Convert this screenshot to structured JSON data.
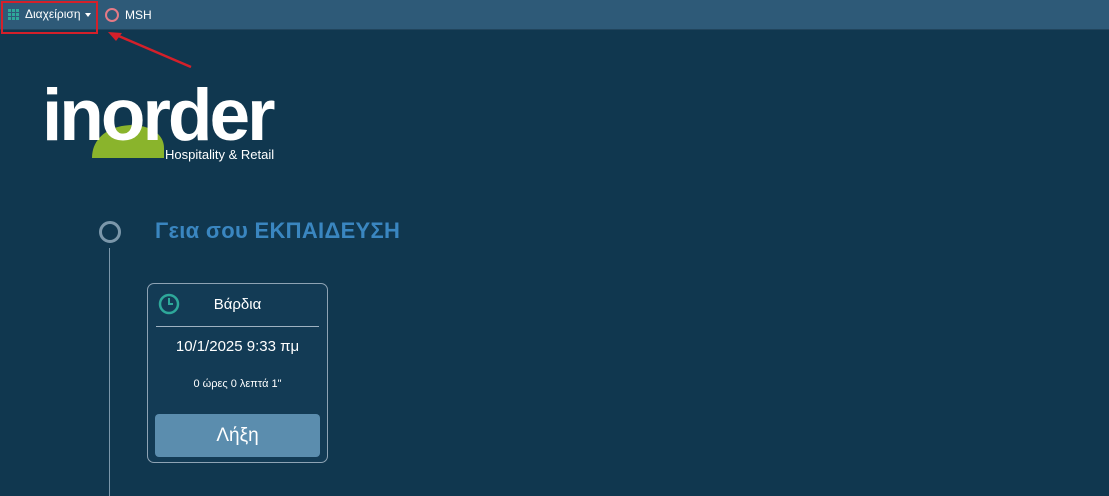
{
  "topbar": {
    "menu_label": "Διαχείριση",
    "menu_icon": "grid-icon",
    "msh_label": "MSH",
    "accent_color": "#2ea89a",
    "highlight_color": "#d4202a"
  },
  "logo": {
    "name": "inorder",
    "tagline": "Hospitality & Retail",
    "brand_green": "#8ab42c"
  },
  "greeting": "Γεια σου ΕΚΠΑΙΔΕΥΣΗ",
  "shift": {
    "title": "Βάρδια",
    "icon": "clock-icon",
    "start_time": "10/1/2025 9:33 πμ",
    "duration": "0 ώρες 0 λεπτά 1\"",
    "end_button": "Λήξη"
  }
}
